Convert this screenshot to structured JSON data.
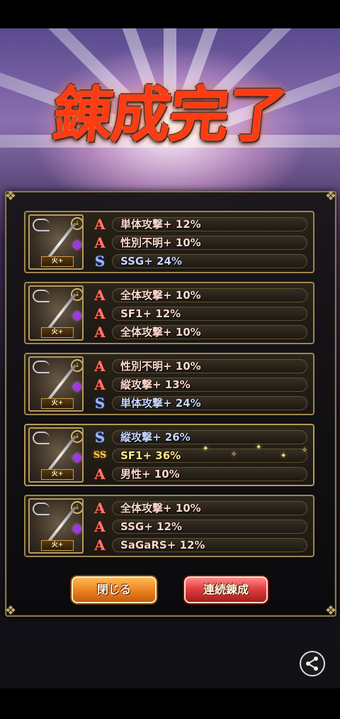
{
  "title": "錬成完了",
  "cards": [
    {
      "tag": "火+",
      "effects": [
        {
          "rarity": "A",
          "text": "単体攻撃+ 12%"
        },
        {
          "rarity": "A",
          "text": "性別不明+ 10%"
        },
        {
          "rarity": "S",
          "text": "SSG+ 24%"
        }
      ]
    },
    {
      "tag": "火+",
      "effects": [
        {
          "rarity": "A",
          "text": "全体攻撃+ 10%"
        },
        {
          "rarity": "A",
          "text": "SF1+ 12%"
        },
        {
          "rarity": "A",
          "text": "全体攻撃+ 10%"
        }
      ]
    },
    {
      "tag": "火+",
      "effects": [
        {
          "rarity": "A",
          "text": "性別不明+ 10%"
        },
        {
          "rarity": "A",
          "text": "縦攻撃+ 13%"
        },
        {
          "rarity": "S",
          "text": "単体攻撃+ 24%"
        }
      ]
    },
    {
      "tag": "火+",
      "effects": [
        {
          "rarity": "S",
          "text": "縦攻撃+ 26%"
        },
        {
          "rarity": "SS",
          "text": "SF1+ 36%"
        },
        {
          "rarity": "A",
          "text": "男性+ 10%"
        }
      ]
    },
    {
      "tag": "火+",
      "effects": [
        {
          "rarity": "A",
          "text": "全体攻撃+ 10%"
        },
        {
          "rarity": "A",
          "text": "SSG+ 12%"
        },
        {
          "rarity": "A",
          "text": "SaGaRS+ 12%"
        }
      ]
    }
  ],
  "rarity_glyphs": {
    "A": "A",
    "S": "S",
    "SS": "SS"
  },
  "buttons": {
    "close": "閉じる",
    "continue": "連続錬成"
  },
  "share_icon": "share-icon",
  "colors": {
    "title": "#ff3b12",
    "rank_A": "#ff7a6a",
    "rank_S": "#9ab8ff",
    "rank_SS": "#ffd45a",
    "close_button": "#f08a24",
    "continue_button": "#e04040"
  }
}
